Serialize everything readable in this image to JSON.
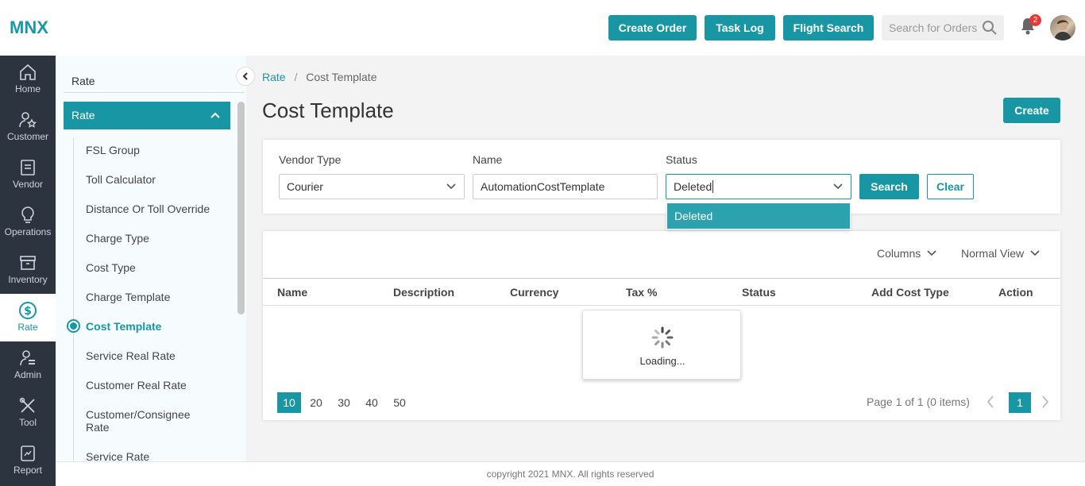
{
  "header": {
    "logo": "MNX",
    "buttons": [
      "Create Order",
      "Task Log",
      "Flight Search"
    ],
    "search_placeholder": "Search for Orders",
    "notification_count": "2",
    "accent": "#1896a4"
  },
  "leftnav": {
    "items": [
      {
        "label": "Home",
        "icon": "home-icon"
      },
      {
        "label": "Customer",
        "icon": "customer-icon"
      },
      {
        "label": "Vendor",
        "icon": "vendor-icon"
      },
      {
        "label": "Operations",
        "icon": "lightbulb-icon"
      },
      {
        "label": "Inventory",
        "icon": "archive-icon"
      },
      {
        "label": "Rate",
        "icon": "dollar-icon"
      },
      {
        "label": "Admin",
        "icon": "admin-icon"
      },
      {
        "label": "Tool",
        "icon": "tools-icon"
      },
      {
        "label": "Report",
        "icon": "report-icon"
      }
    ]
  },
  "subnav": {
    "title": "Rate",
    "group": "Rate",
    "items": [
      "FSL Group",
      "Toll Calculator",
      "Distance Or Toll Override",
      "Charge Type",
      "Cost Type",
      "Charge Template",
      "Cost Template",
      "Service Real Rate",
      "Customer Real Rate",
      "Customer/Consignee Rate",
      "Service Rate"
    ],
    "active_index": 6
  },
  "breadcrumb": {
    "parent": "Rate",
    "separator": "/",
    "current": "Cost Template"
  },
  "page": {
    "title": "Cost Template",
    "create_label": "Create"
  },
  "filters": {
    "vendor_type_label": "Vendor Type",
    "vendor_type_value": "Courier",
    "name_label": "Name",
    "name_value": "AutomationCostTemplate",
    "status_label": "Status",
    "status_value": "Deleted",
    "search_label": "Search",
    "clear_label": "Clear",
    "dropdown_option": "Deleted"
  },
  "grid": {
    "columns_label": "Columns",
    "view_label": "Normal View",
    "headers": [
      "Name",
      "Description",
      "Currency",
      "Tax %",
      "Status",
      "Add Cost Type",
      "Action"
    ],
    "loading_text": "Loading...",
    "page_sizes": [
      "10",
      "20",
      "30",
      "40",
      "50"
    ],
    "page_info": "Page 1 of 1 (0 items)",
    "current_page": "1"
  },
  "footer": {
    "text": "copyright 2021 MNX. All rights reserved"
  }
}
